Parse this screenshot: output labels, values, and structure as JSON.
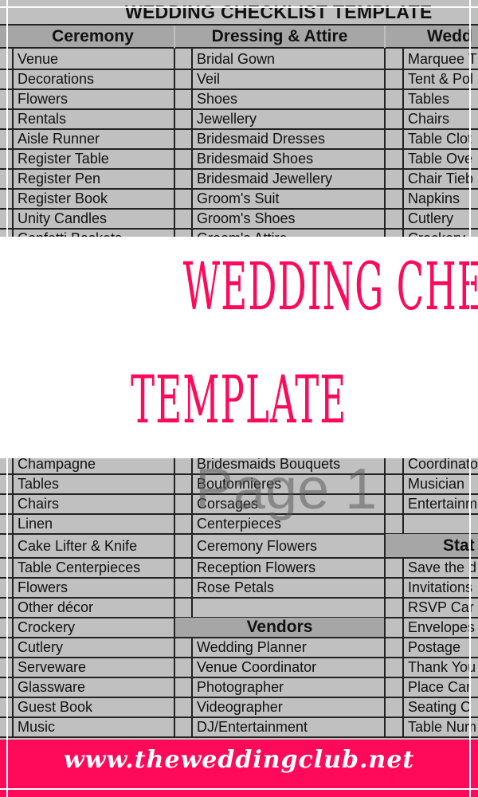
{
  "sheet": {
    "title": "WEDDING CHECKLIST TEMPLATE",
    "watermark": "Page 1",
    "columns": [
      {
        "header": "Ceremony"
      },
      {
        "header": "Dressing & Attire"
      },
      {
        "header": "Wedd"
      }
    ],
    "top_rows": [
      [
        "Venue",
        "Bridal Gown",
        "Marquee T"
      ],
      [
        "Decorations",
        "Veil",
        "Tent & Pol"
      ],
      [
        "Flowers",
        "Shoes",
        "Tables"
      ],
      [
        "Rentals",
        "Jewellery",
        "Chairs"
      ],
      [
        "Aisle Runner",
        "Bridesmaid Dresses",
        "Table Clot"
      ],
      [
        "Register Table",
        "Bridesmaid Shoes",
        "Table Ove"
      ],
      [
        "Register Pen",
        "Bridesmaid Jewellery",
        "Chair Tieb"
      ],
      [
        "Register Book",
        "Groom's Suit",
        "Napkins"
      ],
      [
        "Unity Candles",
        "Groom's Shoes",
        "Cutlery"
      ],
      [
        "Confetti Baskets",
        "Groom's Attire",
        "Crockery"
      ]
    ],
    "bottom_rows": [
      [
        "Champagne",
        "Bridesmaids Bouquets",
        "Coordinato"
      ],
      [
        "Tables",
        "Boutonnieres",
        "Musician"
      ],
      [
        "Chairs",
        "Corsages",
        "Entertainm"
      ],
      [
        "Linen",
        "Centerpieces",
        ""
      ],
      [
        "Cake Lifter & Knife",
        "Ceremony Flowers",
        ""
      ],
      [
        "Table Centerpieces",
        "Reception Flowers",
        "Save the d"
      ],
      [
        "Flowers",
        "Rose Petals",
        "Invitations"
      ],
      [
        "Other décor",
        "",
        "RSVP Car"
      ],
      [
        "Crockery",
        "",
        "Envelopes"
      ],
      [
        "Cutlery",
        "Wedding Planner",
        "Postage"
      ],
      [
        "Serveware",
        "Venue Coordinator",
        "Thank You"
      ],
      [
        "Glassware",
        "Photographer",
        "Place Car"
      ],
      [
        "Guest Book",
        "Videographer",
        "Seating C"
      ],
      [
        "Music",
        "DJ/Entertainment",
        "Table Num"
      ]
    ],
    "section_headers": {
      "vendors": "Vendors",
      "stationery": "Stat"
    }
  },
  "banner": {
    "line1": "WEDDING CHECKLIST",
    "line2": "TEMPLATE",
    "color": "#ff0a5a"
  },
  "footer": {
    "url": "www.theweddingclub.net",
    "color": "#ff0a5a"
  }
}
